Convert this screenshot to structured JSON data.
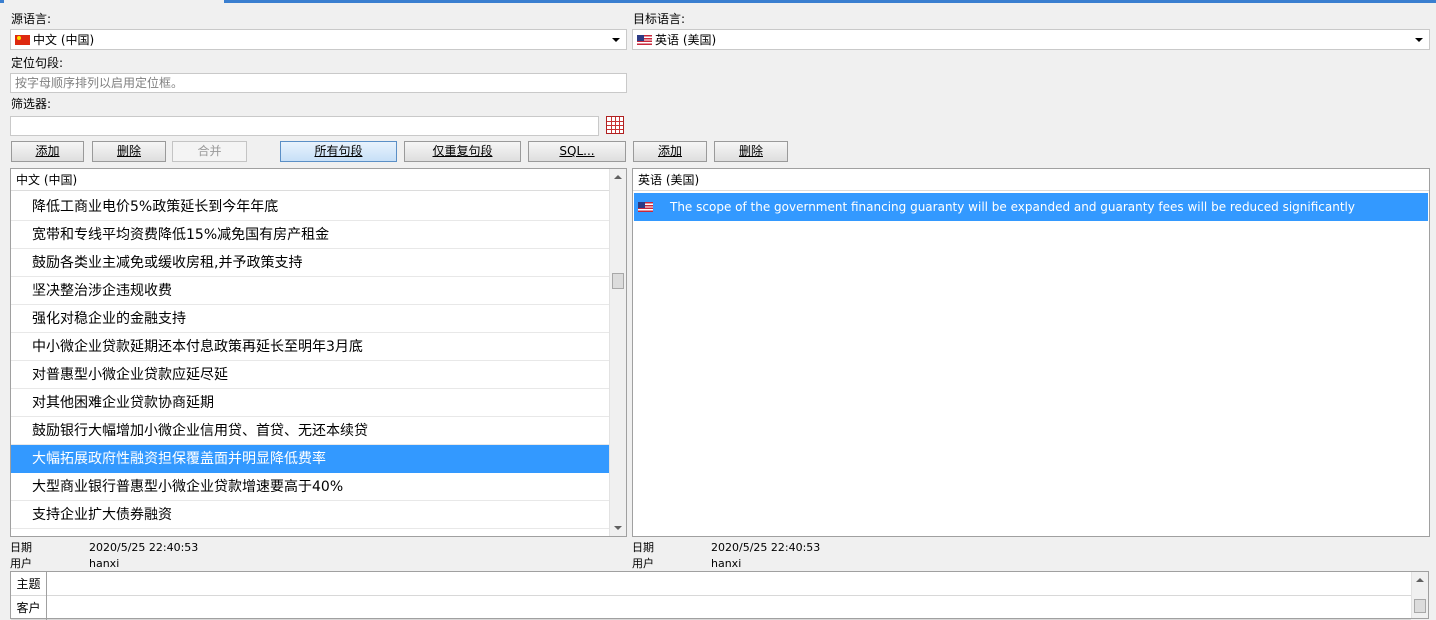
{
  "source": {
    "label": "源语言:",
    "language": "中文 (中国)",
    "flag": "cn-flag-icon"
  },
  "target": {
    "label": "目标语言:",
    "language": "英语 (美国)",
    "flag": "us-flag-icon"
  },
  "locate": {
    "label": "定位句段:",
    "placeholder": "按字母顺序排列以启用定位框。"
  },
  "filter": {
    "label": "筛选器:",
    "value": ""
  },
  "buttons": {
    "add": "添加",
    "delete": "删除",
    "merge": "合并",
    "all_segments": "所有句段",
    "repeated_segments": "仅重复句段",
    "sql": "SQL...",
    "target_add": "添加",
    "target_delete": "删除"
  },
  "source_list": {
    "header": "中文 (中国)",
    "rows": [
      "降低工商业电价5%政策延长到今年年底",
      "宽带和专线平均资费降低15%减免国有房产租金",
      "鼓励各类业主减免或缓收房租,并予政策支持",
      "坚决整治涉企违规收费",
      "强化对稳企业的金融支持",
      "中小微企业贷款延期还本付息政策再延长至明年3月底",
      "对普惠型小微企业贷款应延尽延",
      "对其他困难企业贷款协商延期",
      "鼓励银行大幅增加小微企业信用贷、首贷、无还本续贷",
      "大幅拓展政府性融资担保覆盖面并明显降低费率",
      "大型商业银行普惠型小微企业贷款增速要高于40%",
      "支持企业扩大债券融资"
    ],
    "selected_index": 9
  },
  "target_list": {
    "header": "英语 (美国)",
    "rows": [
      "The scope of the government financing guaranty will be expanded and guaranty fees will be reduced significantly"
    ]
  },
  "source_meta": {
    "date_label": "日期",
    "date_value": "2020/5/25 22:40:53",
    "user_label": "用户",
    "user_value": "hanxi"
  },
  "target_meta": {
    "date_label": "日期",
    "date_value": "2020/5/25 22:40:53",
    "user_label": "用户",
    "user_value": "hanxi"
  },
  "fields": [
    {
      "label": "主题",
      "value": ""
    },
    {
      "label": "客户",
      "value": ""
    }
  ],
  "colors": {
    "selection": "#3399ff",
    "accent": "#3a7fd0"
  }
}
